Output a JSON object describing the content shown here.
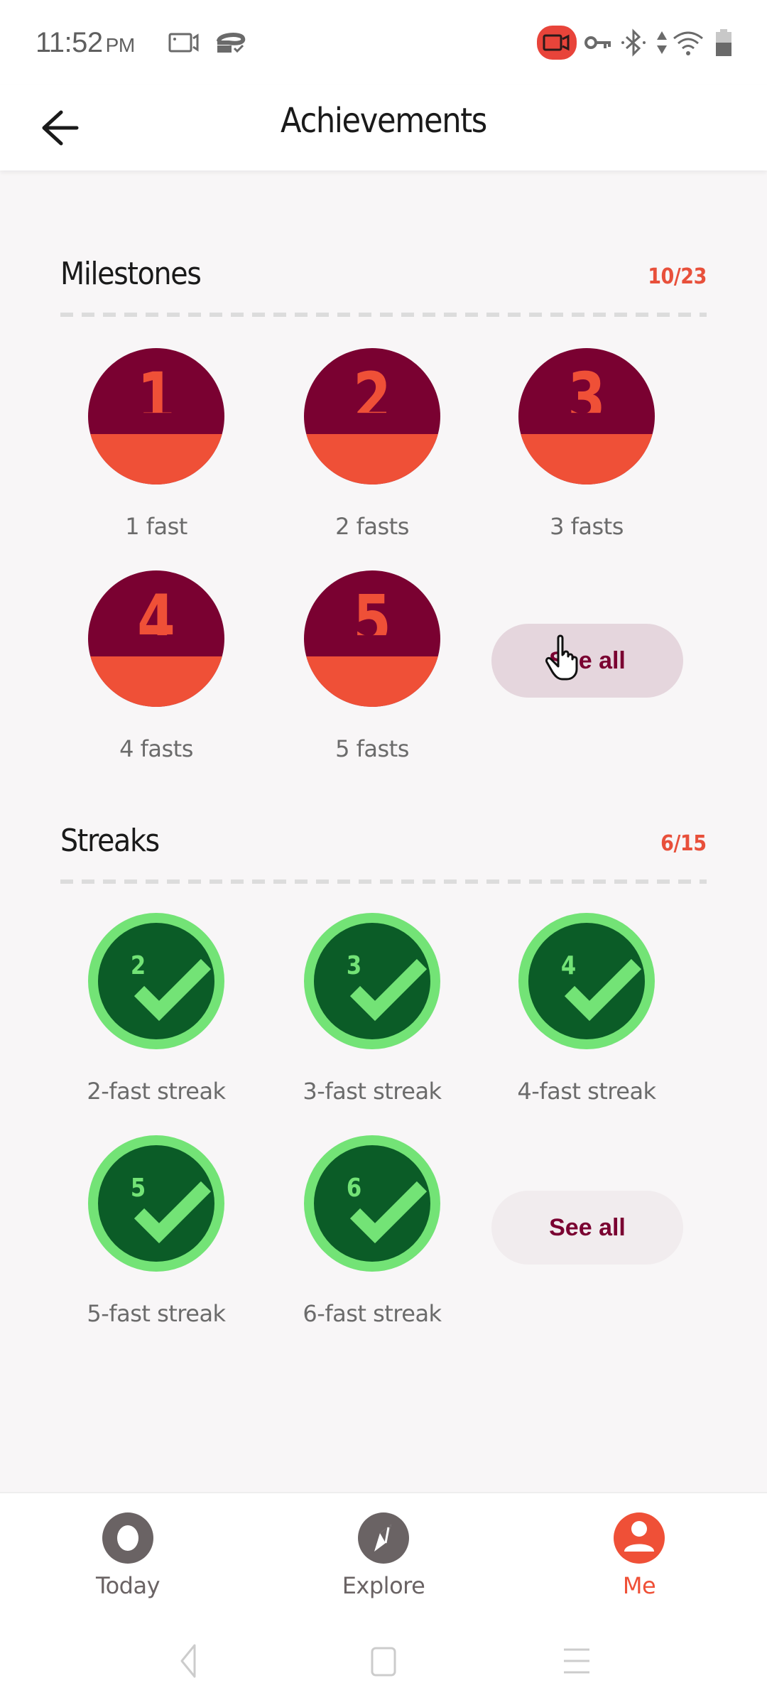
{
  "status_bar": {
    "time": "11:52",
    "ampm": "PM",
    "icons": [
      "screen-record-icon",
      "sync-icon",
      "recording-active-icon",
      "vpn-key-icon",
      "bluetooth-icon",
      "data-arrows-icon",
      "wifi-icon",
      "battery-icon"
    ]
  },
  "app_bar": {
    "title": "Achievements",
    "back_icon": "arrow-left-icon"
  },
  "colors": {
    "accent": "#ef5037",
    "maroon": "#7a0131",
    "streak_dark": "#0b5c27",
    "streak_light": "#73e376"
  },
  "milestones": {
    "title": "Milestones",
    "count": "10/23",
    "badges": [
      {
        "number": "1",
        "label": "1 fast"
      },
      {
        "number": "2",
        "label": "2 fasts"
      },
      {
        "number": "3",
        "label": "3 fasts"
      },
      {
        "number": "4",
        "label": "4 fasts"
      },
      {
        "number": "5",
        "label": "5 fasts"
      }
    ],
    "see_all": "See all"
  },
  "streaks": {
    "title": "Streaks",
    "count": "6/15",
    "badges": [
      {
        "number": "2",
        "label": "2-fast streak"
      },
      {
        "number": "3",
        "label": "3-fast streak"
      },
      {
        "number": "4",
        "label": "4-fast streak"
      },
      {
        "number": "5",
        "label": "5-fast streak"
      },
      {
        "number": "6",
        "label": "6-fast streak"
      }
    ],
    "see_all": "See all"
  },
  "bottom_nav": {
    "items": [
      {
        "label": "Today",
        "icon": "today-ring-icon",
        "active": false
      },
      {
        "label": "Explore",
        "icon": "compass-icon",
        "active": false
      },
      {
        "label": "Me",
        "icon": "profile-icon",
        "active": true
      }
    ]
  },
  "system_nav": [
    "back-triangle-icon",
    "home-square-icon",
    "recents-menu-icon"
  ]
}
